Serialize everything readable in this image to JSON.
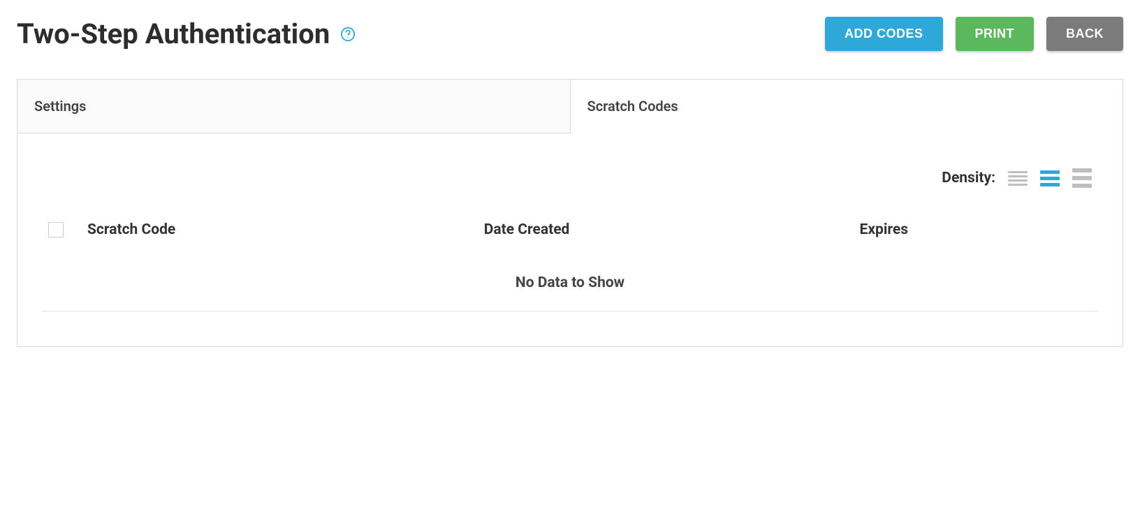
{
  "header": {
    "title": "Two-Step Authentication"
  },
  "actions": {
    "add_codes": "ADD CODES",
    "print": "PRINT",
    "back": "BACK"
  },
  "tabs": {
    "settings": "Settings",
    "scratch_codes": "Scratch Codes"
  },
  "density": {
    "label": "Density:"
  },
  "table": {
    "headers": {
      "scratch_code": "Scratch Code",
      "date_created": "Date Created",
      "expires": "Expires"
    },
    "empty": "No Data to Show",
    "rows": []
  }
}
